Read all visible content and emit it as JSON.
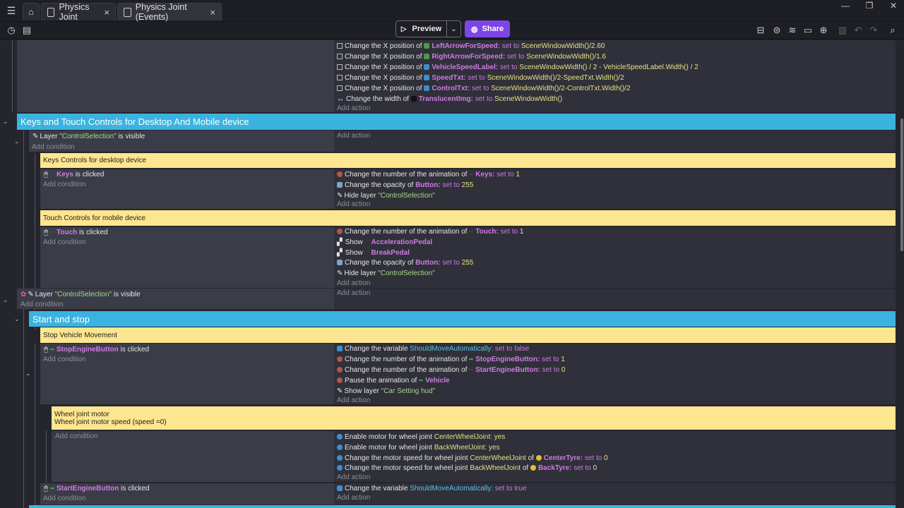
{
  "tabs": [
    {
      "label": "Physics Joint"
    },
    {
      "label": "Physics Joint (Events)"
    }
  ],
  "toolbar": {
    "preview_label": "Preview",
    "share_label": "Share"
  },
  "colors": {
    "banner": "#3bb3e0",
    "comment": "#fde68f",
    "object": "#d07ae5",
    "value": "#e7e189",
    "string": "#a8d98a",
    "accent": "#7e45e6"
  },
  "sections": {
    "s1": {
      "title": "Keys and Touch Controls for Desktop And Mobile device"
    },
    "s2": {
      "title": "Start and stop"
    }
  },
  "hints": {
    "add_action": "Add action",
    "add_condition": "Add condition"
  },
  "events": {
    "top_actions": [
      {
        "pre": "Change the X position of",
        "obj": "LeftArrowForSpeed:",
        "mid": "set to",
        "val": "SceneWindowWidth()/2.60"
      },
      {
        "pre": "Change the X position of",
        "obj": "RightArrowForSpeed:",
        "mid": "set to",
        "val": "SceneWindowWidth()/1.6"
      },
      {
        "pre": "Change the X position of",
        "obj": "VehicleSpeedLabel:",
        "mid": "set to",
        "val": "SceneWindowWidth() / 2 - VehicleSpeedLabel.Width() / 2"
      },
      {
        "pre": "Change the X position of",
        "obj": "SpeedTxt:",
        "mid": "set to",
        "val": "SceneWindowWidth()/2-SpeedTxt.Width()/2"
      },
      {
        "pre": "Change the X position of",
        "obj": "ControlTxt:",
        "mid": "set to",
        "val": "SceneWindowWidth()/2-ControlTxt.Width()/2"
      },
      {
        "pre": "Change the width of",
        "obj": "TranslucentImg:",
        "mid": "set to",
        "val": "SceneWindowWidth()"
      }
    ],
    "layer_cond1": {
      "pre": "Layer",
      "str": "\"ControlSelection\"",
      "post": "is visible"
    },
    "comment_keys": "Keys Controls for desktop device",
    "keys_cond": {
      "obj": "Keys",
      "post": "is clicked"
    },
    "keys_actions": [
      {
        "pre": "Change the number of the animation of",
        "obj": "Keys:",
        "mid": "set to",
        "val": "1"
      },
      {
        "pre": "Change the opacity of",
        "obj": "Button:",
        "mid": "set to",
        "val": "255"
      },
      {
        "pre": "Hide layer",
        "str": "\"ControlSelection\""
      }
    ],
    "comment_touch": "Touch Controls for mobile device",
    "touch_cond": {
      "obj": "Touch",
      "post": "is clicked"
    },
    "touch_actions": [
      {
        "pre": "Change the number of the animation of",
        "obj": "Touch:",
        "mid": "set to",
        "val": "1"
      },
      {
        "pre": "Show",
        "obj": "AccelerationPedal"
      },
      {
        "pre": "Show",
        "obj": "BreakPedal"
      },
      {
        "pre": "Change the opacity of",
        "obj": "Button:",
        "mid": "set to",
        "val": "255"
      },
      {
        "pre": "Hide layer",
        "str": "\"ControlSelection\""
      }
    ],
    "layer_cond2": {
      "pre": "Layer",
      "str": "\"ControlSelection\"",
      "post": "is visible"
    },
    "comment_stop": "Stop Vehicle Movement",
    "stop_cond": {
      "obj": "StopEngineButton",
      "post": "is clicked"
    },
    "stop_actions": [
      {
        "pre": "Change the variable",
        "var": "ShouldMoveAutomatically:",
        "mid": "set to false"
      },
      {
        "pre": "Change the number of the animation of",
        "obj": "StopEngineButton:",
        "mid": "set to",
        "val": "1"
      },
      {
        "pre": "Change the number of the animation of",
        "obj": "StartEngineButton:",
        "mid": "set to",
        "val": "0"
      },
      {
        "pre": "Pause the animation of",
        "obj": "Vehicle"
      },
      {
        "pre": "Show layer",
        "str": "\"Car Setting hud\""
      }
    ],
    "comment_wheel_line1": "Wheel joint motor",
    "comment_wheel_line2": "Wheel joint motor speed (speed =0)",
    "wheel_actions": [
      {
        "pre": "Enable motor for wheel joint",
        "val": "CenterWheelJoint:",
        "post": "yes"
      },
      {
        "pre": "Enable motor for wheel joint",
        "val": "BackWheelJoint:",
        "post": "yes"
      },
      {
        "pre": "Change the motor speed for wheel joint",
        "val": "CenterWheelJoint",
        "mid": "of",
        "obj": "CenterTyre:",
        "tail": "set to",
        "num": "0"
      },
      {
        "pre": "Change the motor speed for wheel joint",
        "val": "BackWheelJoint",
        "mid": "of",
        "obj": "BackTyre:",
        "tail": "set to",
        "num": "0"
      }
    ],
    "start_cond": {
      "obj": "StartEngineButton",
      "post": "is clicked"
    },
    "start_actions": [
      {
        "pre": "Change the variable",
        "var": "ShouldMoveAutomatically:",
        "mid": "set to true"
      }
    ]
  }
}
